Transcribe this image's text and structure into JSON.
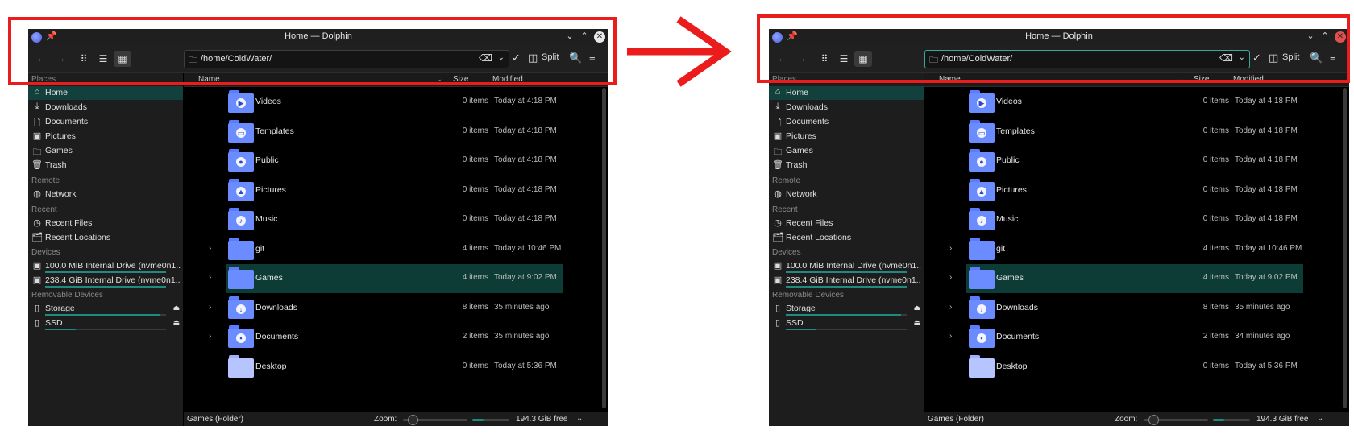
{
  "colors": {
    "accent": "#1f8a80",
    "selection": "#0d3b36",
    "folder": "#6b8cff",
    "arrow": "#ea1c1c",
    "close_active": "#e0514f"
  },
  "before": {
    "title": "Home — Dolphin",
    "location_path": "/home/ColdWater/",
    "split_label": "Split",
    "sidebar": {
      "sections": [
        "Places",
        "Remote",
        "Recent",
        "Devices",
        "Removable Devices"
      ],
      "places": [
        {
          "label": "Home",
          "icon": "home-icon"
        },
        {
          "label": "Downloads",
          "icon": "download-icon"
        },
        {
          "label": "Documents",
          "icon": "document-icon"
        },
        {
          "label": "Pictures",
          "icon": "picture-icon"
        },
        {
          "label": "Games",
          "icon": "folder-icon"
        },
        {
          "label": "Trash",
          "icon": "trash-icon"
        }
      ],
      "remote": [
        {
          "label": "Network",
          "icon": "network-icon"
        }
      ],
      "recent": [
        {
          "label": "Recent Files",
          "icon": "clock-icon"
        },
        {
          "label": "Recent Locations",
          "icon": "folder-clock-icon"
        }
      ],
      "devices": [
        {
          "label": "100.0 MiB Internal Drive (nvme0n1..."
        },
        {
          "label": "238.4 GiB Internal Drive (nvme0n1..."
        }
      ],
      "removable": [
        {
          "label": "Storage",
          "usage": 0.95
        },
        {
          "label": "SSD",
          "usage": 0.25
        }
      ]
    },
    "columns": {
      "name": "Name",
      "size": "Size",
      "modified": "Modified"
    },
    "files": [
      {
        "name": "Videos",
        "size": "0 items",
        "modified": "Today at 4:18 PM"
      },
      {
        "name": "Templates",
        "size": "0 items",
        "modified": "Today at 4:18 PM"
      },
      {
        "name": "Public",
        "size": "0 items",
        "modified": "Today at 4:18 PM"
      },
      {
        "name": "Pictures",
        "size": "0 items",
        "modified": "Today at 4:18 PM"
      },
      {
        "name": "Music",
        "size": "0 items",
        "modified": "Today at 4:18 PM"
      },
      {
        "name": "git",
        "size": "4 items",
        "modified": "Today at 10:46 PM"
      },
      {
        "name": "Games",
        "size": "4 items",
        "modified": "Today at 9:02 PM"
      },
      {
        "name": "Downloads",
        "size": "8 items",
        "modified": "35 minutes ago"
      },
      {
        "name": "Documents",
        "size": "2 items",
        "modified": "35 minutes ago"
      },
      {
        "name": "Desktop",
        "size": "0 items",
        "modified": "Today at 5:36 PM"
      }
    ],
    "status": {
      "selection": "Games (Folder)",
      "zoom_label": "Zoom:",
      "free": "194.3 GiB free",
      "free_fraction": 0.3
    }
  },
  "after": {
    "title": "Home — Dolphin",
    "location_path": "/home/ColdWater/",
    "split_label": "Split",
    "sidebar": {
      "sections": [
        "Places",
        "Remote",
        "Recent",
        "Devices",
        "Removable Devices"
      ],
      "places": [
        {
          "label": "Home",
          "icon": "home-icon"
        },
        {
          "label": "Downloads",
          "icon": "download-icon"
        },
        {
          "label": "Documents",
          "icon": "document-icon"
        },
        {
          "label": "Pictures",
          "icon": "picture-icon"
        },
        {
          "label": "Games",
          "icon": "folder-icon"
        },
        {
          "label": "Trash",
          "icon": "trash-icon"
        }
      ],
      "remote": [
        {
          "label": "Network",
          "icon": "network-icon"
        }
      ],
      "recent": [
        {
          "label": "Recent Files",
          "icon": "clock-icon"
        },
        {
          "label": "Recent Locations",
          "icon": "folder-clock-icon"
        }
      ],
      "devices": [
        {
          "label": "100.0 MiB Internal Drive (nvme0n1..."
        },
        {
          "label": "238.4 GiB Internal Drive (nvme0n1..."
        }
      ],
      "removable": [
        {
          "label": "Storage",
          "usage": 0.95
        },
        {
          "label": "SSD",
          "usage": 0.25
        }
      ]
    },
    "columns": {
      "name": "Name",
      "size": "Size",
      "modified": "Modified"
    },
    "files": [
      {
        "name": "Videos",
        "size": "0 items",
        "modified": "Today at 4:18 PM"
      },
      {
        "name": "Templates",
        "size": "0 items",
        "modified": "Today at 4:18 PM"
      },
      {
        "name": "Public",
        "size": "0 items",
        "modified": "Today at 4:18 PM"
      },
      {
        "name": "Pictures",
        "size": "0 items",
        "modified": "Today at 4:18 PM"
      },
      {
        "name": "Music",
        "size": "0 items",
        "modified": "Today at 4:18 PM"
      },
      {
        "name": "git",
        "size": "4 items",
        "modified": "Today at 10:46 PM"
      },
      {
        "name": "Games",
        "size": "4 items",
        "modified": "Today at 9:02 PM"
      },
      {
        "name": "Downloads",
        "size": "8 items",
        "modified": "35 minutes ago"
      },
      {
        "name": "Documents",
        "size": "2 items",
        "modified": "34 minutes ago"
      },
      {
        "name": "Desktop",
        "size": "0 items",
        "modified": "Today at 5:36 PM"
      }
    ],
    "status": {
      "selection": "Games (Folder)",
      "zoom_label": "Zoom:",
      "free": "194.3 GiB free",
      "free_fraction": 0.3
    }
  }
}
